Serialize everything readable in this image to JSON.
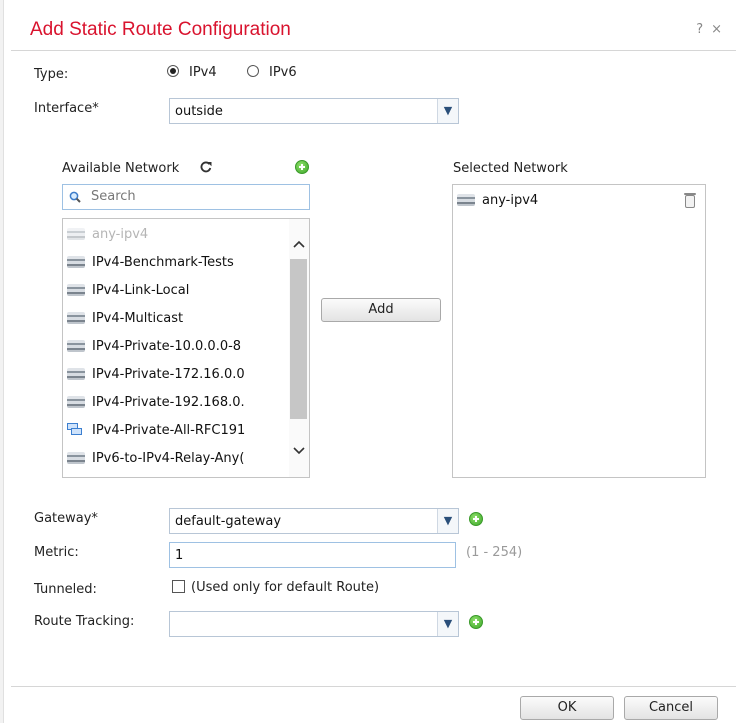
{
  "dialog": {
    "title": "Add Static Route Configuration",
    "help_glyph": "?",
    "close_glyph": "×"
  },
  "form": {
    "type_label": "Type:",
    "ipv4_label": "IPv4",
    "ipv6_label": "IPv6",
    "type_selected": "IPv4",
    "interface_label": "Interface*",
    "interface_value": "outside",
    "available_label": "Available Network",
    "search_placeholder": "Search",
    "selected_label": "Selected Network",
    "add_label": "Add",
    "gateway_label": "Gateway*",
    "gateway_value": "default-gateway",
    "metric_label": "Metric:",
    "metric_value": "1",
    "metric_hint": "(1 - 254)",
    "tunneled_label": "Tunneled:",
    "tunneled_hint": "(Used only for default Route)",
    "tunneled_checked": false,
    "tracking_label": "Route Tracking:",
    "tracking_value": ""
  },
  "available_networks": [
    {
      "name": "any-ipv4",
      "icon": "network-icon",
      "disabled": true
    },
    {
      "name": "IPv4-Benchmark-Tests",
      "icon": "network-icon",
      "disabled": false
    },
    {
      "name": "IPv4-Link-Local",
      "icon": "network-icon",
      "disabled": false
    },
    {
      "name": "IPv4-Multicast",
      "icon": "network-icon",
      "disabled": false
    },
    {
      "name": "IPv4-Private-10.0.0.0-8",
      "icon": "network-icon",
      "disabled": false
    },
    {
      "name": "IPv4-Private-172.16.0.0",
      "icon": "network-icon",
      "disabled": false
    },
    {
      "name": "IPv4-Private-192.168.0.",
      "icon": "network-icon",
      "disabled": false
    },
    {
      "name": "IPv4-Private-All-RFC191",
      "icon": "network-group-icon",
      "disabled": false
    },
    {
      "name": "IPv6-to-IPv4-Relay-Any(",
      "icon": "network-icon",
      "disabled": false
    }
  ],
  "selected_networks": [
    {
      "name": "any-ipv4",
      "icon": "network-icon"
    }
  ],
  "footer": {
    "ok_label": "OK",
    "cancel_label": "Cancel"
  },
  "colors": {
    "title": "#d9132e",
    "add_icon": "#3da62a",
    "input_border": "#9ec1e3"
  }
}
